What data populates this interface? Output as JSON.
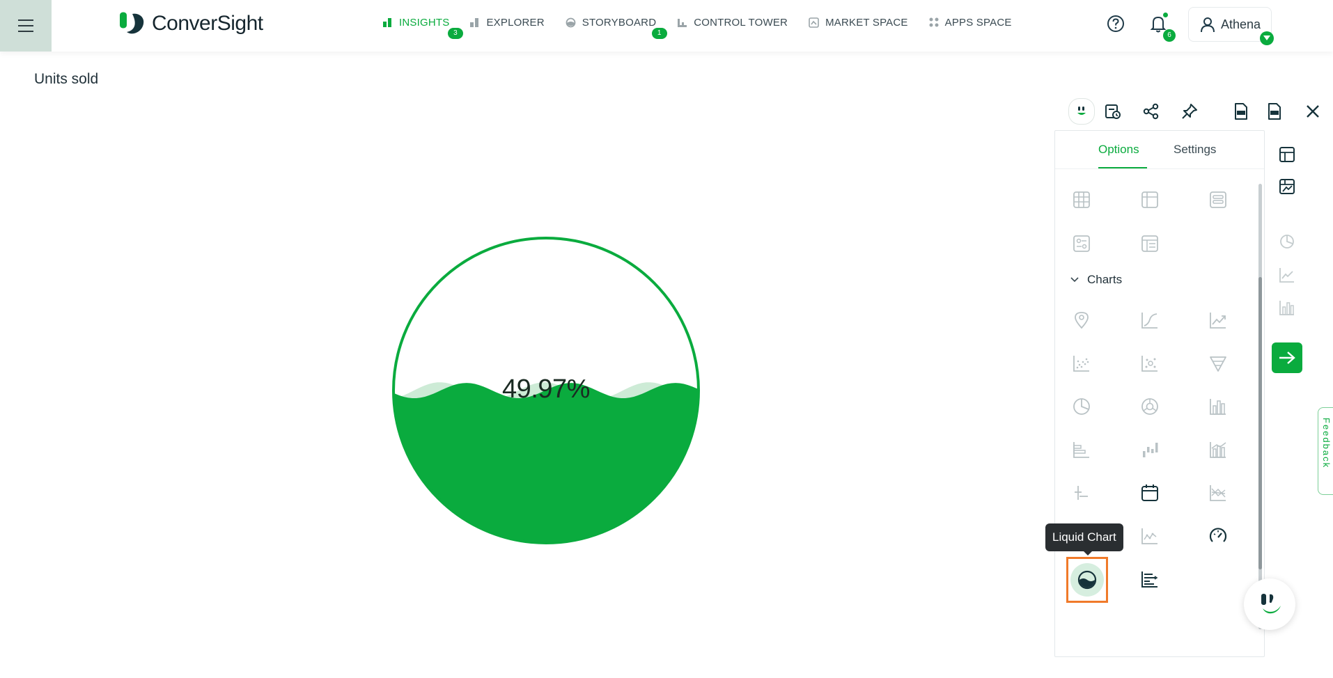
{
  "app": {
    "brand": "ConverSight",
    "user_name": "Athena",
    "notification_count": "6"
  },
  "nav": [
    {
      "label": "INSIGHTS",
      "icon": "bar-chart-icon",
      "badge": "3",
      "active": true
    },
    {
      "label": "EXPLORER",
      "icon": "bar-chart-icon",
      "badge": "",
      "active": false
    },
    {
      "label": "STORYBOARD",
      "icon": "storyboard-icon",
      "badge": "1",
      "active": false
    },
    {
      "label": "CONTROL TOWER",
      "icon": "control-tower-icon",
      "badge": "",
      "active": false
    },
    {
      "label": "MARKET SPACE",
      "icon": "market-space-icon",
      "badge": "",
      "active": false
    },
    {
      "label": "APPS SPACE",
      "icon": "apps-grid-icon",
      "badge": "",
      "active": false
    }
  ],
  "main": {
    "title": "Units sold",
    "liquid_value_label": "49.97%",
    "liquid_fill_fraction": 0.4997
  },
  "panel": {
    "tabs": [
      {
        "label": "Options",
        "active": true
      },
      {
        "label": "Settings",
        "active": false
      }
    ],
    "charts_section_label": "Charts",
    "tooltip": "Liquid Chart",
    "selected_chart": "liquid-chart"
  },
  "feedback_label": "Feedback",
  "colors": {
    "accent": "#0aab3e",
    "liquid_fill": "#0aab3e",
    "liquid_wave_light": "#cdebd6",
    "selection_outline": "#f07a2a",
    "icon_gray": "#b9c2c5",
    "icon_dark": "#16333b"
  }
}
